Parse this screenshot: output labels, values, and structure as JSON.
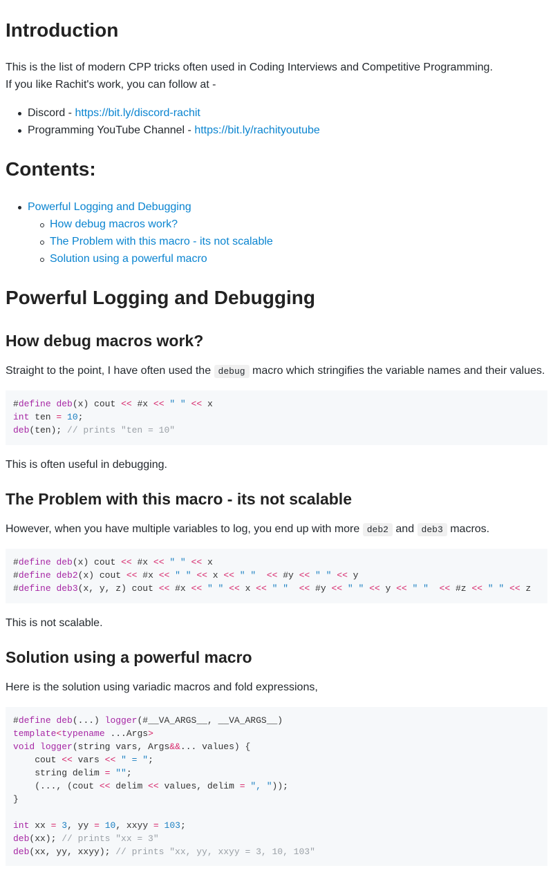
{
  "intro": {
    "heading": "Introduction",
    "line1": "This is the list of modern CPP tricks often used in Coding Interviews and Competitive Programming.",
    "line2": "If you like Rachit's work, you can follow at -",
    "links": [
      {
        "label": "Discord - ",
        "text": "https://bit.ly/discord-rachit"
      },
      {
        "label": "Programming YouTube Channel - ",
        "text": "https://bit.ly/rachityoutube"
      }
    ]
  },
  "contents": {
    "heading": "Contents:",
    "items": [
      {
        "text": "Powerful Logging and Debugging"
      },
      {
        "text": "How debug macros work?"
      },
      {
        "text": "The Problem with this macro - its not scalable"
      },
      {
        "text": "Solution using a powerful macro"
      }
    ]
  },
  "section1": {
    "heading": "Powerful Logging and Debugging"
  },
  "how": {
    "heading": "How debug macros work?",
    "text_before": "Straight to the point, I have often used the ",
    "code": "debug",
    "text_after": " macro which stringifies the variable names and their values.",
    "after_text": "This is often useful in debugging."
  },
  "problem": {
    "heading": "The Problem with this macro - its not scalable",
    "text_before": "However, when you have multiple variables to log, you end up with more ",
    "code1": "deb2",
    "text_mid": " and ",
    "code2": "deb3",
    "text_after": " macros.",
    "after_text": "This is not scalable."
  },
  "solution": {
    "heading": "Solution using a powerful macro",
    "text": "Here is the solution using variadic macros and fold expressions,"
  }
}
